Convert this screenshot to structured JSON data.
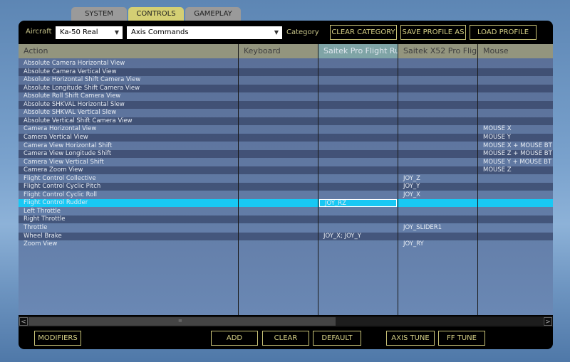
{
  "tabs": [
    {
      "label": "SYSTEM",
      "active": false
    },
    {
      "label": "CONTROLS",
      "active": true
    },
    {
      "label": "GAMEPLAY",
      "active": false
    }
  ],
  "toolbar": {
    "aircraft_label": "Aircraft",
    "aircraft_value": "Ka-50 Real",
    "category_value": "Axis Commands",
    "category_label": "Category",
    "clear_category": "CLEAR CATEGORY",
    "save_profile_as": "SAVE PROFILE AS",
    "load_profile": "LOAD PROFILE"
  },
  "columns": [
    "Action",
    "Keyboard",
    "Saitek Pro Flight Ru",
    "Saitek X52 Pro Flig",
    "Mouse"
  ],
  "rows": [
    {
      "action": "Absolute Camera Horizontal View",
      "keyboard": "",
      "pro_flight": "",
      "x52": "",
      "mouse": ""
    },
    {
      "action": "Absolute Camera Vertical View",
      "keyboard": "",
      "pro_flight": "",
      "x52": "",
      "mouse": ""
    },
    {
      "action": "Absolute Horizontal Shift Camera View",
      "keyboard": "",
      "pro_flight": "",
      "x52": "",
      "mouse": ""
    },
    {
      "action": "Absolute Longitude Shift Camera View",
      "keyboard": "",
      "pro_flight": "",
      "x52": "",
      "mouse": ""
    },
    {
      "action": "Absolute Roll Shift Camera View",
      "keyboard": "",
      "pro_flight": "",
      "x52": "",
      "mouse": ""
    },
    {
      "action": "Absolute SHKVAL Horizontal Slew",
      "keyboard": "",
      "pro_flight": "",
      "x52": "",
      "mouse": ""
    },
    {
      "action": "Absolute SHKVAL Vertical Slew",
      "keyboard": "",
      "pro_flight": "",
      "x52": "",
      "mouse": ""
    },
    {
      "action": "Absolute Vertical Shift Camera View",
      "keyboard": "",
      "pro_flight": "",
      "x52": "",
      "mouse": ""
    },
    {
      "action": "Camera Horizontal View",
      "keyboard": "",
      "pro_flight": "",
      "x52": "",
      "mouse": "MOUSE X"
    },
    {
      "action": "Camera Vertical View",
      "keyboard": "",
      "pro_flight": "",
      "x52": "",
      "mouse": "MOUSE Y"
    },
    {
      "action": "Camera View Horizontal Shift",
      "keyboard": "",
      "pro_flight": "",
      "x52": "",
      "mouse": "MOUSE X + MOUSE BT"
    },
    {
      "action": "Camera View Longitude Shift",
      "keyboard": "",
      "pro_flight": "",
      "x52": "",
      "mouse": "MOUSE Z + MOUSE BT"
    },
    {
      "action": "Camera View Vertical Shift",
      "keyboard": "",
      "pro_flight": "",
      "x52": "",
      "mouse": "MOUSE Y + MOUSE BT"
    },
    {
      "action": "Camera Zoom View",
      "keyboard": "",
      "pro_flight": "",
      "x52": "",
      "mouse": "MOUSE Z"
    },
    {
      "action": "Flight Control Collective",
      "keyboard": "",
      "pro_flight": "",
      "x52": "JOY_Z",
      "mouse": ""
    },
    {
      "action": "Flight Control Cyclic Pitch",
      "keyboard": "",
      "pro_flight": "",
      "x52": "JOY_Y",
      "mouse": ""
    },
    {
      "action": "Flight Control Cyclic Roll",
      "keyboard": "",
      "pro_flight": "",
      "x52": "JOY_X",
      "mouse": ""
    },
    {
      "action": "Flight Control Rudder",
      "keyboard": "",
      "pro_flight": "JOY_RZ",
      "x52": "",
      "mouse": "",
      "selected": true
    },
    {
      "action": "Left Throttle",
      "keyboard": "",
      "pro_flight": "",
      "x52": "",
      "mouse": ""
    },
    {
      "action": "Right Throttle",
      "keyboard": "",
      "pro_flight": "",
      "x52": "",
      "mouse": ""
    },
    {
      "action": "Throttle",
      "keyboard": "",
      "pro_flight": "",
      "x52": "JOY_SLIDER1",
      "mouse": ""
    },
    {
      "action": "Wheel Brake",
      "keyboard": "",
      "pro_flight": "JOY_X; JOY_Y",
      "x52": "",
      "mouse": ""
    },
    {
      "action": "Zoom View",
      "keyboard": "",
      "pro_flight": "",
      "x52": "JOY_RY",
      "mouse": ""
    }
  ],
  "scroll": {
    "left_arrow": "<",
    "right_arrow": ">",
    "grip": "≡"
  },
  "bottom": {
    "modifiers": "MODIFIERS",
    "add": "ADD",
    "clear": "CLEAR",
    "default": "DEFAULT",
    "axis_tune": "AXIS TUNE",
    "ff_tune": "FF TUNE"
  },
  "colors": {
    "accent": "#c8c276",
    "highlight": "#18c8f4",
    "active_tab": "#d4cf74"
  }
}
